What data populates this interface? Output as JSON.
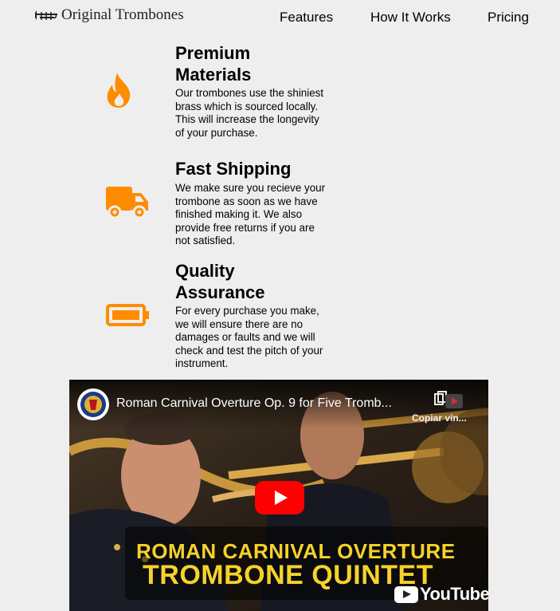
{
  "header": {
    "brand": "Original Trombones",
    "nav": [
      "Features",
      "How It Works",
      "Pricing"
    ]
  },
  "features": [
    {
      "icon": "fire-icon",
      "title_line1": "Premium",
      "title_line2": "Materials",
      "lines": [
        "Our trombones use the shiniest",
        "brass which is sourced locally.",
        "This will increase the longevity",
        "of your purchase."
      ]
    },
    {
      "icon": "truck-icon",
      "title_line1": "Fast Shipping",
      "lines": [
        "We make sure you recieve your",
        "trombone as soon as we have",
        "finished making it. We also",
        "provide free returns if you are",
        "not satisfied."
      ]
    },
    {
      "icon": "battery-icon",
      "title_line1": "Quality",
      "title_line2": "Assurance",
      "lines": [
        "For every purchase you make,",
        "we will ensure there are no",
        "damages or faults and we will",
        "check and test the pitch of your",
        "instrument."
      ]
    }
  ],
  "video": {
    "title": "Roman Carnival Overture Op. 9 for Five Tromb...",
    "copy_label": "Copiar vín...",
    "banner_line1": "ROMAN CARNIVAL OVERTURE",
    "banner_line2": "TROMBONE QUINTET",
    "youtube_label": "YouTube"
  },
  "colors": {
    "accent": "#ff8c00",
    "background": "#eeeeee",
    "play": "#ff0000",
    "banner_text": "#f6d22a"
  }
}
